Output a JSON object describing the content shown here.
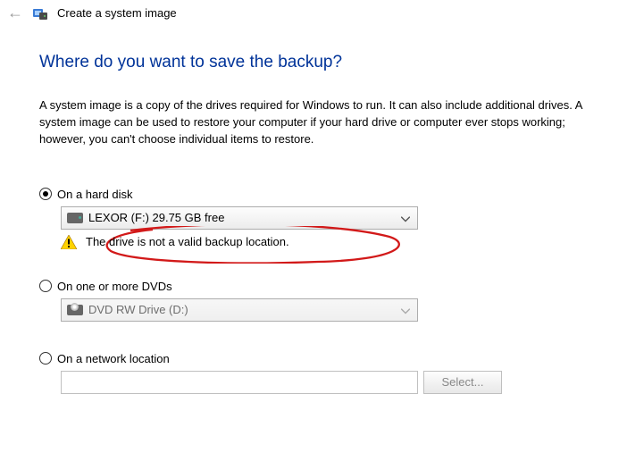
{
  "header": {
    "title": "Create a system image"
  },
  "heading": "Where do you want to save the backup?",
  "description": "A system image is a copy of the drives required for Windows to run. It can also include additional drives. A system image can be used to restore your computer if your hard drive or computer ever stops working; however, you can't choose individual items to restore.",
  "options": {
    "hard_disk": {
      "label": "On a hard disk",
      "selected_drive": "LEXOR (F:)  29.75 GB free",
      "warning": "The drive is not a valid backup location."
    },
    "dvd": {
      "label": "On one or more DVDs",
      "selected_drive": "DVD RW Drive (D:)"
    },
    "network": {
      "label": "On a network location",
      "path": "",
      "select_button": "Select..."
    }
  }
}
